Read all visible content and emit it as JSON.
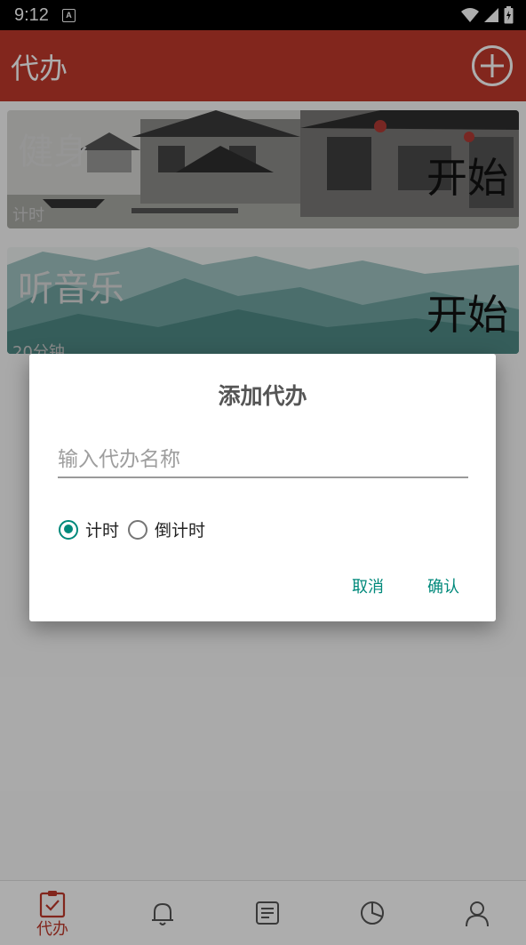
{
  "status_bar": {
    "time": "9:12",
    "notif_glyph": "A"
  },
  "app_bar": {
    "title": "代办",
    "add_icon": "plus-circle-icon"
  },
  "cards": [
    {
      "title": "健身",
      "subtitle": "计时",
      "action": "开始"
    },
    {
      "title": "听音乐",
      "subtitle": "20分钟",
      "action": "开始"
    }
  ],
  "dialog": {
    "title": "添加代办",
    "input_placeholder": "输入代办名称",
    "input_value": "",
    "radio_options": [
      {
        "label": "计时",
        "selected": true
      },
      {
        "label": "倒计时",
        "selected": false
      }
    ],
    "cancel_label": "取消",
    "confirm_label": "确认"
  },
  "bottom_nav": {
    "items": [
      {
        "label": "代办",
        "icon": "clipboard-check-icon",
        "active": true
      },
      {
        "label": "",
        "icon": "bell-icon",
        "active": false
      },
      {
        "label": "",
        "icon": "notes-icon",
        "active": false
      },
      {
        "label": "",
        "icon": "pie-chart-icon",
        "active": false
      },
      {
        "label": "",
        "icon": "person-icon",
        "active": false
      }
    ]
  },
  "colors": {
    "primary": "#c0392b",
    "accent": "#00897b"
  }
}
